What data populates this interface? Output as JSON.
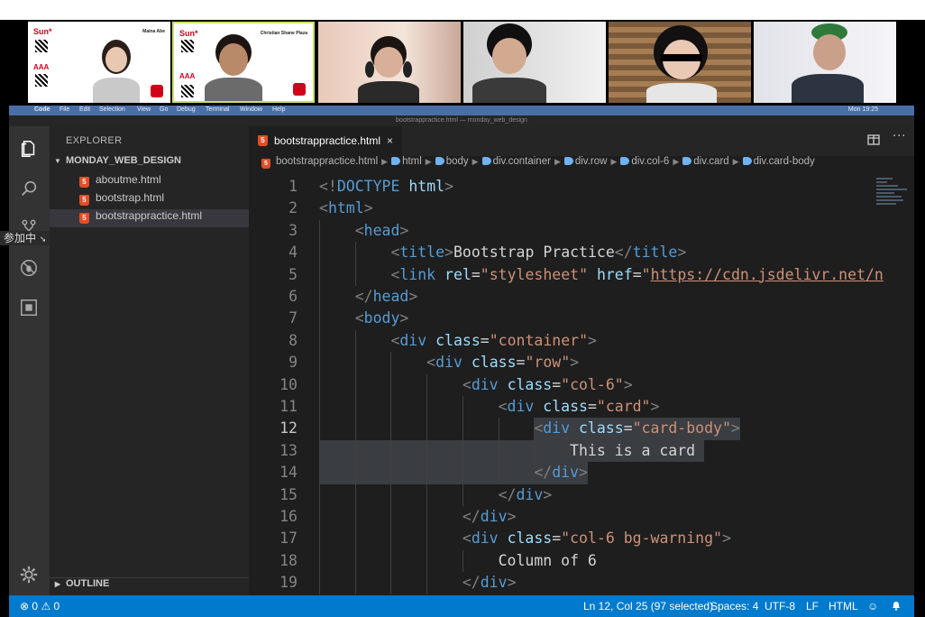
{
  "menubar": {
    "apple": "",
    "app": "Code",
    "items": [
      "File",
      "Edit",
      "Selection",
      "View",
      "Go",
      "Debug",
      "Terminal",
      "Window",
      "Help"
    ],
    "clock": "Mon 19:25",
    "window_title": "bootstrappractice.html — monday_web_design"
  },
  "video_tiles": [
    {
      "brand": "Sun*",
      "presenter": "Maina Abe",
      "aaa": "AAA"
    },
    {
      "brand": "Sun*",
      "presenter": "Christian Shane Plaza",
      "aaa": "AAA"
    }
  ],
  "ime_badge": "参加中",
  "sidebar": {
    "title": "EXPLORER",
    "folder": "MONDAY_WEB_DESIGN",
    "files": [
      {
        "name": "aboutme.html",
        "active": false
      },
      {
        "name": "bootstrap.html",
        "active": false
      },
      {
        "name": "bootstrappractice.html",
        "active": true
      }
    ],
    "outline": "OUTLINE"
  },
  "editor": {
    "tab_label": "bootstrappractice.html",
    "tab_close": "×",
    "split_icon": "split-editor-icon",
    "more_icon": "more-actions-icon",
    "breadcrumb": [
      "bootstrappractice.html",
      "html",
      "body",
      "div.container",
      "div.row",
      "div.col-6",
      "div.card",
      "div.card-body"
    ]
  },
  "code": {
    "current_line": 12,
    "lines": [
      {
        "n": "1",
        "indent": 0,
        "parts": [
          [
            "br",
            "<!"
          ],
          [
            "tag",
            "DOCTYPE "
          ],
          [
            "attr",
            "html"
          ],
          [
            "br",
            ">"
          ]
        ]
      },
      {
        "n": "2",
        "indent": 0,
        "parts": [
          [
            "br",
            "<"
          ],
          [
            "tag",
            "html"
          ],
          [
            "br",
            ">"
          ]
        ]
      },
      {
        "n": "3",
        "indent": 1,
        "parts": [
          [
            "br",
            "<"
          ],
          [
            "tag",
            "head"
          ],
          [
            "br",
            ">"
          ]
        ]
      },
      {
        "n": "4",
        "indent": 2,
        "parts": [
          [
            "br",
            "<"
          ],
          [
            "tag",
            "title"
          ],
          [
            "br",
            ">"
          ],
          [
            "txt",
            "Bootstrap Practice"
          ],
          [
            "br",
            "</"
          ],
          [
            "tag",
            "title"
          ],
          [
            "br",
            ">"
          ]
        ]
      },
      {
        "n": "5",
        "indent": 2,
        "parts": [
          [
            "br",
            "<"
          ],
          [
            "tag",
            "link "
          ],
          [
            "attr",
            "rel"
          ],
          [
            "txt",
            "="
          ],
          [
            "str",
            "\"stylesheet\" "
          ],
          [
            "attr",
            "href"
          ],
          [
            "txt",
            "="
          ],
          [
            "str",
            "\""
          ],
          [
            "url",
            "https://cdn.jsdelivr.net/n"
          ]
        ]
      },
      {
        "n": "6",
        "indent": 1,
        "parts": [
          [
            "br",
            "</"
          ],
          [
            "tag",
            "head"
          ],
          [
            "br",
            ">"
          ]
        ]
      },
      {
        "n": "7",
        "indent": 1,
        "parts": [
          [
            "br",
            "<"
          ],
          [
            "tag",
            "body"
          ],
          [
            "br",
            ">"
          ]
        ]
      },
      {
        "n": "8",
        "indent": 2,
        "parts": [
          [
            "br",
            "<"
          ],
          [
            "tag",
            "div "
          ],
          [
            "attr",
            "class"
          ],
          [
            "txt",
            "="
          ],
          [
            "str",
            "\"container\""
          ],
          [
            "br",
            ">"
          ]
        ]
      },
      {
        "n": "9",
        "indent": 3,
        "parts": [
          [
            "br",
            "<"
          ],
          [
            "tag",
            "div "
          ],
          [
            "attr",
            "class"
          ],
          [
            "txt",
            "="
          ],
          [
            "str",
            "\"row\""
          ],
          [
            "br",
            ">"
          ]
        ]
      },
      {
        "n": "10",
        "indent": 4,
        "parts": [
          [
            "br",
            "<"
          ],
          [
            "tag",
            "div "
          ],
          [
            "attr",
            "class"
          ],
          [
            "txt",
            "="
          ],
          [
            "str",
            "\"col-6\""
          ],
          [
            "br",
            ">"
          ]
        ]
      },
      {
        "n": "11",
        "indent": 5,
        "parts": [
          [
            "br",
            "<"
          ],
          [
            "tag",
            "div "
          ],
          [
            "attr",
            "class"
          ],
          [
            "txt",
            "="
          ],
          [
            "str",
            "\"card\""
          ],
          [
            "br",
            ">"
          ]
        ]
      },
      {
        "n": "12",
        "indent": 6,
        "parts": [
          [
            "br",
            "<"
          ],
          [
            "tag",
            "div "
          ],
          [
            "attr",
            "class"
          ],
          [
            "txt",
            "="
          ],
          [
            "str",
            "\"card-body\""
          ],
          [
            "br",
            ">"
          ]
        ]
      },
      {
        "n": "13",
        "indent": 7,
        "parts": [
          [
            "txt",
            "This is a card"
          ]
        ]
      },
      {
        "n": "14",
        "indent": 6,
        "parts": [
          [
            "br",
            "</"
          ],
          [
            "tag",
            "div"
          ],
          [
            "br",
            ">"
          ]
        ]
      },
      {
        "n": "15",
        "indent": 5,
        "parts": [
          [
            "br",
            "</"
          ],
          [
            "tag",
            "div"
          ],
          [
            "br",
            ">"
          ]
        ]
      },
      {
        "n": "16",
        "indent": 4,
        "parts": [
          [
            "br",
            "</"
          ],
          [
            "tag",
            "div"
          ],
          [
            "br",
            ">"
          ]
        ]
      },
      {
        "n": "17",
        "indent": 4,
        "parts": [
          [
            "br",
            "<"
          ],
          [
            "tag",
            "div "
          ],
          [
            "attr",
            "class"
          ],
          [
            "txt",
            "="
          ],
          [
            "str",
            "\"col-6 bg-warning\""
          ],
          [
            "br",
            ">"
          ]
        ]
      },
      {
        "n": "18",
        "indent": 5,
        "parts": [
          [
            "txt",
            "Column of 6"
          ]
        ]
      },
      {
        "n": "19",
        "indent": 4,
        "parts": [
          [
            "br",
            "</"
          ],
          [
            "tag",
            "div"
          ],
          [
            "br",
            ">"
          ]
        ]
      }
    ]
  },
  "statusbar": {
    "errors": "0",
    "warnings": "0",
    "position": "Ln 12, Col 25 (97 selected)",
    "spaces": "Spaces: 4",
    "encoding": "UTF-8",
    "eol": "LF",
    "language": "HTML"
  },
  "colors": {
    "statusbar": "#007acc",
    "tag": "#569cd6",
    "attr": "#9cdcfe",
    "string": "#ce9178"
  }
}
